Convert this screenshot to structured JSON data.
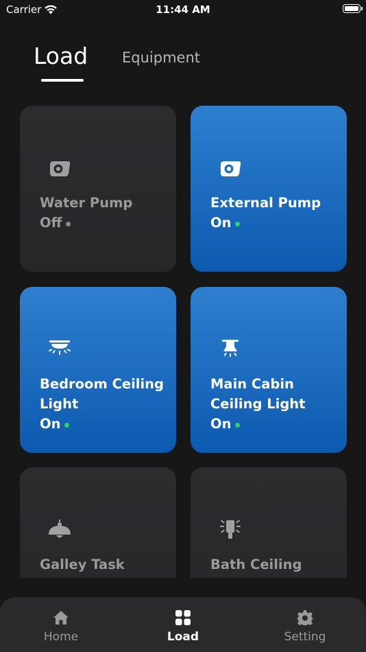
{
  "status_bar": {
    "carrier": "Carrier",
    "time": "11:44 AM"
  },
  "tabs": [
    {
      "label": "Load",
      "active": true
    },
    {
      "label": "Equipment",
      "active": false
    }
  ],
  "cards": [
    {
      "name": "Water Pump",
      "state": "Off",
      "icon": "pump-icon"
    },
    {
      "name": "External Pump",
      "state": "On",
      "icon": "pump-icon"
    },
    {
      "name": "Bedroom Ceiling Light",
      "state": "On",
      "icon": "ceiling-light-icon"
    },
    {
      "name": "Main Cabin Ceiling Light",
      "state": "On",
      "icon": "ceiling-lamp-icon"
    },
    {
      "name": "Galley Task Light",
      "state": "",
      "icon": "pendant-lamp-icon"
    },
    {
      "name": "Bath Ceiling Light",
      "state": "",
      "icon": "bulb-rays-icon"
    }
  ],
  "nav": [
    {
      "label": "Home",
      "icon": "home-icon",
      "active": false
    },
    {
      "label": "Load",
      "icon": "grid-icon",
      "active": true
    },
    {
      "label": "Setting",
      "icon": "gear-icon",
      "active": false
    }
  ],
  "colors": {
    "background": "#171717",
    "card_off": "#2a2a2d",
    "card_on_top": "#2e7fd0",
    "card_on_bottom": "#0c5aaf",
    "on_dot": "#2bd56a",
    "off_dot": "#8a8a8a"
  }
}
